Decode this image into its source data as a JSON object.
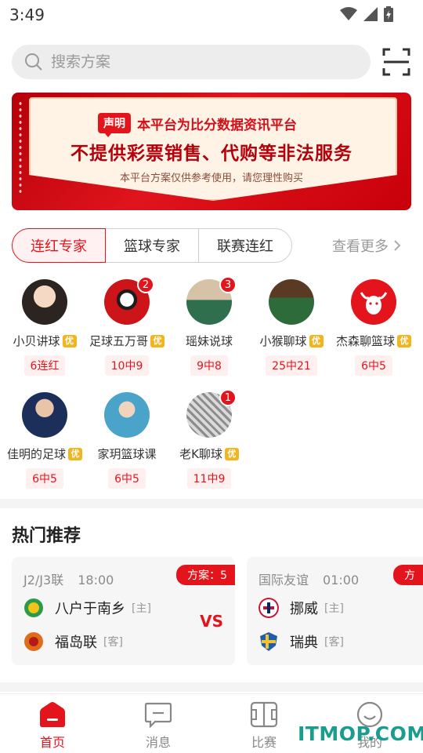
{
  "status": {
    "time": "3:49"
  },
  "search": {
    "placeholder": "搜索方案"
  },
  "banner": {
    "tag": "声明",
    "title": "本平台为比分数据资讯平台",
    "main": "不提供彩票销售、代购等非法服务",
    "sub": "本平台方案仅供参考使用，请您理性购买"
  },
  "tabs": [
    {
      "label": "连红专家",
      "active": true
    },
    {
      "label": "篮球专家",
      "active": false
    },
    {
      "label": "联赛连红",
      "active": false
    }
  ],
  "see_more": "查看更多",
  "experts": [
    {
      "name": "小贝讲球",
      "vip": "优",
      "streak": "6连红",
      "badge": ""
    },
    {
      "name": "足球五万哥",
      "vip": "优",
      "streak": "10中9",
      "badge": "2"
    },
    {
      "name": "瑶妹说球",
      "vip": "",
      "streak": "9中8",
      "badge": "3"
    },
    {
      "name": "小猴聊球",
      "vip": "优",
      "streak": "25中21",
      "badge": ""
    },
    {
      "name": "杰森聊篮球",
      "vip": "优",
      "streak": "6中5",
      "badge": ""
    },
    {
      "name": "佳明的足球",
      "vip": "优",
      "streak": "6中5",
      "badge": ""
    },
    {
      "name": "家玥篮球课",
      "vip": "",
      "streak": "6中5",
      "badge": ""
    },
    {
      "name": "老K聊球",
      "vip": "优",
      "streak": "11中9",
      "badge": "1"
    }
  ],
  "hot": {
    "title": "热门推荐",
    "matches": [
      {
        "league": "J2/J3联",
        "time": "18:00",
        "plan": "方案：5",
        "home": {
          "name": "八户于南乡",
          "role": "[主]"
        },
        "away": {
          "name": "福岛联",
          "role": "[客]"
        },
        "vs": "VS"
      },
      {
        "league": "国际友谊",
        "time": "01:00",
        "plan": "方",
        "home": {
          "name": "挪威",
          "role": "[主]"
        },
        "away": {
          "name": "瑞典",
          "role": "[客]"
        }
      }
    ]
  },
  "nav": [
    {
      "label": "首页",
      "icon": "home-icon",
      "active": true
    },
    {
      "label": "消息",
      "icon": "message-icon",
      "active": false
    },
    {
      "label": "比赛",
      "icon": "pitch-icon",
      "active": false
    },
    {
      "label": "我的",
      "icon": "smiley-icon",
      "active": false
    }
  ],
  "watermark": "ITMOP.COM",
  "colors": {
    "accent": "#e4141c",
    "vip": "#f3b51e"
  }
}
